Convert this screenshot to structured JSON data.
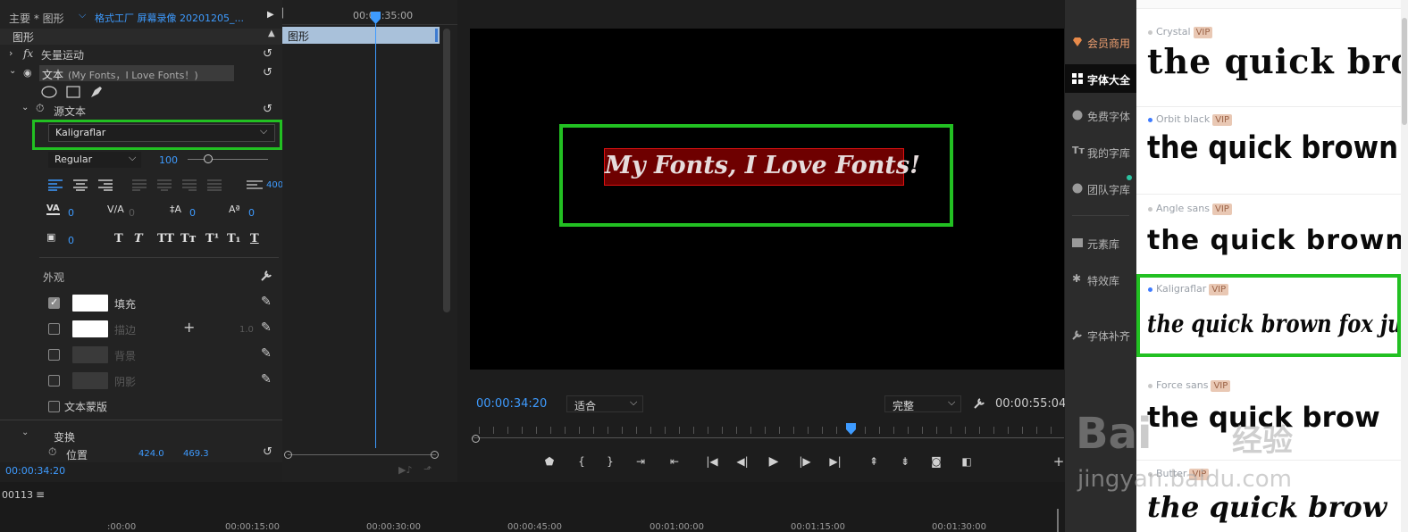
{
  "panel": {
    "tab_main": "主要 * 图形",
    "tab_clip": "格式工厂 屏幕录像 20201205_...",
    "section_graphic": "图形",
    "vector_motion": "矢量运动",
    "text_layer": "文本",
    "text_layer_detail": "(My Fonts，I Love Fonts！)",
    "source_text": "源文本",
    "font_family": "Kaligraflar",
    "font_style": "Regular",
    "font_size": "100",
    "tracking_val": "400",
    "kerning_val": "0",
    "tracking2_val": "0",
    "leading_val": "0",
    "baseline_val": "0",
    "tsume_val": "0",
    "appearance": "外观",
    "fill_label": "填充",
    "stroke_label": "描边",
    "stroke_width": "1.0",
    "background_label": "背景",
    "shadow_label": "阴影",
    "text_mask": "文本蒙版",
    "transform": "变换",
    "position_label": "位置",
    "position_x": "424.0",
    "position_y": "469.3",
    "current_time": "00:00:34:20"
  },
  "mini_timeline": {
    "time_label": "00:00:35:00",
    "clip_label": "图形"
  },
  "monitor": {
    "overlay_text": "My Fonts, I Love Fonts!",
    "timecode": "00:00:34:20",
    "fit_option": "适合",
    "quality_option": "完整",
    "duration": "00:00:55:04"
  },
  "bottom_timeline": {
    "sequence": "00113",
    "menu_icon": "≡",
    "ticks": [
      ":00:00",
      "00:00:15:00",
      "00:00:30:00",
      "00:00:45:00",
      "00:01:00:00",
      "00:01:15:00",
      "00:01:30:00"
    ]
  },
  "sidebar": {
    "items": [
      {
        "label": "会员商用",
        "icon": "diamond-icon"
      },
      {
        "label": "字体大全",
        "icon": "grid-icon"
      },
      {
        "label": "免费字体",
        "icon": "coin-icon"
      },
      {
        "label": "我的字库",
        "icon": "font-icon"
      },
      {
        "label": "团队字库",
        "icon": "team-icon"
      },
      {
        "label": "元素库",
        "icon": "image-icon"
      },
      {
        "label": "特效库",
        "icon": "effects-icon"
      },
      {
        "label": "字体补齐",
        "icon": "wrench-icon"
      }
    ]
  },
  "font_list": {
    "fonts": [
      {
        "name": "Crystal",
        "vip": "VIP",
        "sample": "the quick bro"
      },
      {
        "name": "Orbit black",
        "vip": "VIP",
        "sample": "the quick brown f"
      },
      {
        "name": "Angle sans",
        "vip": "VIP",
        "sample": "the quick brown"
      },
      {
        "name": "Kaligraflar",
        "vip": "VIP",
        "sample": "the quick brown fox ju"
      },
      {
        "name": "Force sans",
        "vip": "VIP",
        "sample": "the quick brow"
      },
      {
        "name": "Butter",
        "vip": "VIP",
        "sample": "the quick brow"
      }
    ]
  },
  "watermark": {
    "brand": "Bai",
    "brand_cn": "经验",
    "url": "jingyan.baidu.com"
  },
  "colors": {
    "accent_blue": "#3e9bff",
    "highlight_green": "#22c022",
    "text_bg_red": "#6e0000",
    "vip_bg": "#e9c8b4"
  }
}
